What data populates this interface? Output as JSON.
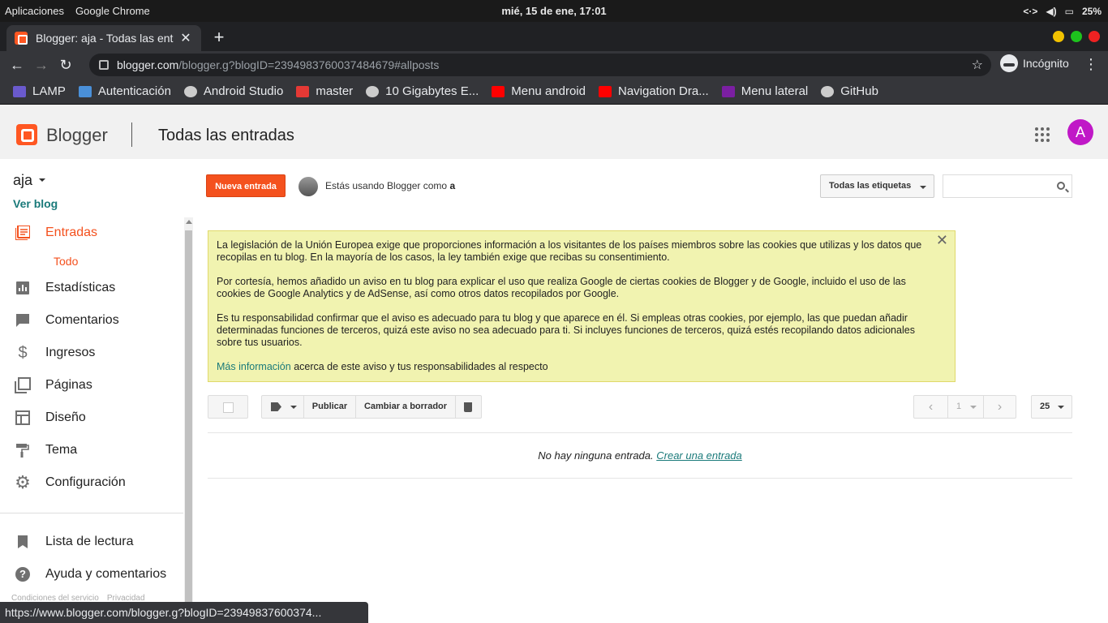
{
  "os": {
    "apps_label": "Aplicaciones",
    "app_name": "Google Chrome",
    "clock": "mié, 15 de ene, 17:01",
    "battery": "25%"
  },
  "browser": {
    "tab_title": "Blogger: aja - Todas las ent",
    "url_host": "blogger.com",
    "url_path": "/blogger.g?blogID=2394983760037484679#allposts",
    "incognito_label": "Incógnito",
    "status_url": "https://www.blogger.com/blogger.g?blogID=23949837600374..."
  },
  "bookmarks": [
    {
      "label": "LAMP",
      "color": "#6a5acd"
    },
    {
      "label": "Autenticación",
      "color": "#4a90d9"
    },
    {
      "label": "Android Studio",
      "color": "#cccccc"
    },
    {
      "label": "master",
      "color": "#e53935"
    },
    {
      "label": "10 Gigabytes E...",
      "color": "#cccccc"
    },
    {
      "label": "Menu android",
      "color": "#ff0000"
    },
    {
      "label": "Navigation Dra...",
      "color": "#ff0000"
    },
    {
      "label": "Menu lateral",
      "color": "#7b1fa2"
    },
    {
      "label": "GitHub",
      "color": "#cccccc"
    }
  ],
  "header": {
    "brand": "Blogger",
    "page_title": "Todas las entradas",
    "avatar_letter": "A"
  },
  "sidebar": {
    "blog_name": "aja",
    "view_blog": "Ver blog",
    "items": [
      {
        "label": "Entradas",
        "icon": "posts-icon"
      },
      {
        "label": "Estadísticas",
        "icon": "stats-icon"
      },
      {
        "label": "Comentarios",
        "icon": "comments-icon"
      },
      {
        "label": "Ingresos",
        "icon": "dollar-icon"
      },
      {
        "label": "Páginas",
        "icon": "pages-icon"
      },
      {
        "label": "Diseño",
        "icon": "layout-icon"
      },
      {
        "label": "Tema",
        "icon": "paint-roller-icon"
      },
      {
        "label": "Configuración",
        "icon": "gear-icon"
      },
      {
        "label": "Lista de lectura",
        "icon": "bookmark-icon"
      },
      {
        "label": "Ayuda y comentarios",
        "icon": "help-icon"
      }
    ],
    "sub_item": "Todo",
    "footer_terms": "Condiciones del servicio",
    "footer_privacy": "Privacidad"
  },
  "main": {
    "new_post": "Nueva entrada",
    "using_text": "Estás usando Blogger como",
    "using_user": "a",
    "labels_filter": "Todas las etiquetas",
    "notice": {
      "p1": "La legislación de la Unión Europea exige que proporciones información a los visitantes de los países miembros sobre las cookies que utilizas y los datos que recopilas en tu blog. En la mayoría de los casos, la ley también exige que recibas su consentimiento.",
      "p2": "Por cortesía, hemos añadido un aviso en tu blog para explicar el uso que realiza Google de ciertas cookies de Blogger y de Google, incluido el uso de las cookies de Google Analytics y de AdSense, así como otros datos recopilados por Google.",
      "p3": "Es tu responsabilidad confirmar que el aviso es adecuado para tu blog y que aparece en él. Si empleas otras cookies, por ejemplo, las que puedan añadir determinadas funciones de terceros, quizá este aviso no sea adecuado para ti. Si incluyes funciones de terceros, quizá estés recopilando datos adicionales sobre tus usuarios.",
      "link": "Más información",
      "link_suffix": "acerca de este aviso y tus responsabilidades al respecto"
    },
    "actions": {
      "publish": "Publicar",
      "to_draft": "Cambiar a borrador"
    },
    "pager": {
      "page": "1",
      "per_page": "25"
    },
    "empty_text": "No hay ninguna entrada.",
    "create_link": "Crear una entrada"
  }
}
